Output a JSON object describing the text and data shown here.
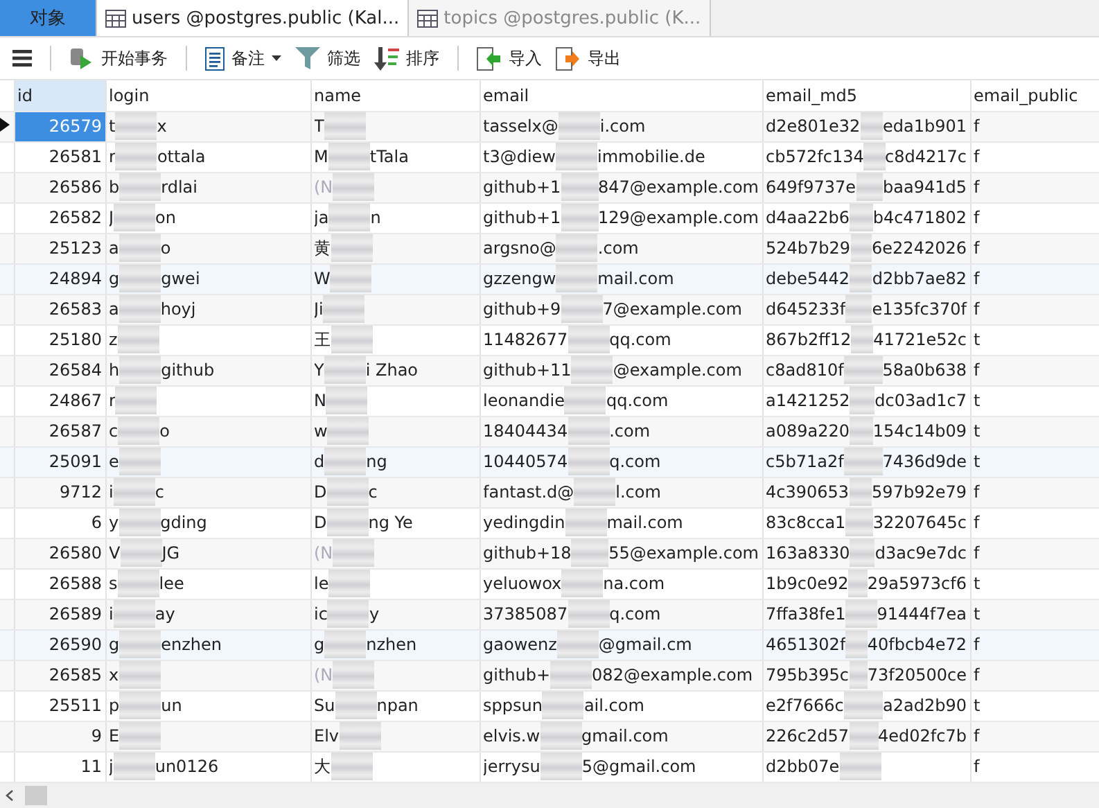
{
  "objects_tab": {
    "label": "对象"
  },
  "tabs": [
    {
      "kind": "table",
      "label": "users @postgres.public (Kal...",
      "selected": true
    },
    {
      "kind": "table",
      "label": "topics @postgres.public (K...",
      "selected": false
    }
  ],
  "toolbar": [
    {
      "kind": "menu"
    },
    {
      "kind": "transaction",
      "label": "开始事务"
    },
    {
      "kind": "note",
      "label": "备注"
    },
    {
      "kind": "filter",
      "label": "筛选"
    },
    {
      "kind": "sort",
      "label": "排序"
    },
    {
      "kind": "import",
      "label": "导入"
    },
    {
      "kind": "export",
      "label": "导出"
    }
  ],
  "columns": [
    {
      "label": "id",
      "selected": true
    },
    {
      "label": "login",
      "selected": false
    },
    {
      "label": "name",
      "selected": false
    },
    {
      "label": "email",
      "selected": false
    },
    {
      "label": "email_md5",
      "selected": false
    },
    {
      "label": "email_public",
      "selected": false
    }
  ],
  "rows": [
    {
      "selected": true,
      "id": "26579",
      "login": [
        "t",
        "x"
      ],
      "name": {
        "kind": "text",
        "parts": [
          "T"
        ]
      },
      "email": [
        "tasselx@",
        "i.com"
      ],
      "email_md5": [
        "d2e801e32",
        "eda1b901"
      ],
      "email_public": "f"
    },
    {
      "selected": false,
      "id": "26581",
      "login": [
        "r",
        "ottala"
      ],
      "name": {
        "kind": "text",
        "parts": [
          "M",
          "tTala"
        ]
      },
      "email": [
        "t3@diew",
        "immobilie.de"
      ],
      "email_md5": [
        "cb572fc134",
        "c8d4217c"
      ],
      "email_public": "f"
    },
    {
      "selected": false,
      "id": "26586",
      "login": [
        "b",
        "rdlai"
      ],
      "name": {
        "kind": "null",
        "parts": [
          "(N"
        ]
      },
      "email": [
        "github+1",
        "847@example.com"
      ],
      "email_md5": [
        "649f9737e",
        "baa941d5"
      ],
      "email_public": "f"
    },
    {
      "selected": false,
      "id": "26582",
      "login": [
        "J",
        "on"
      ],
      "name": {
        "kind": "text",
        "parts": [
          "ja",
          "n"
        ]
      },
      "email": [
        "github+1",
        "129@example.com"
      ],
      "email_md5": [
        "d4aa22b6",
        "b4c471802"
      ],
      "email_public": "f"
    },
    {
      "selected": false,
      "id": "25123",
      "login": [
        "a",
        "o"
      ],
      "name": {
        "kind": "text",
        "parts": [
          "黄"
        ]
      },
      "email": [
        "argsno@",
        ".com"
      ],
      "email_md5": [
        "524b7b29",
        "6e2242026"
      ],
      "email_public": "f"
    },
    {
      "selected": false,
      "id": "24894",
      "login": [
        "g",
        "gwei"
      ],
      "name": {
        "kind": "text",
        "parts": [
          "W"
        ]
      },
      "email": [
        "gzzengw",
        "mail.com"
      ],
      "email_md5": [
        "debe5442",
        "d2bb7ae82"
      ],
      "email_public": "f"
    },
    {
      "selected": false,
      "id": "26583",
      "login": [
        "a",
        "hoyj"
      ],
      "name": {
        "kind": "text",
        "parts": [
          "Ji"
        ]
      },
      "email": [
        "github+9",
        "7@example.com"
      ],
      "email_md5": [
        "d645233f",
        "e135fc370f"
      ],
      "email_public": "f"
    },
    {
      "selected": false,
      "id": "25180",
      "login": [
        "z"
      ],
      "name": {
        "kind": "text",
        "parts": [
          "王"
        ]
      },
      "email": [
        "11482677",
        "qq.com"
      ],
      "email_md5": [
        "867b2ff12",
        "41721e52c"
      ],
      "email_public": "t"
    },
    {
      "selected": false,
      "id": "26584",
      "login": [
        "h",
        "github"
      ],
      "name": {
        "kind": "text",
        "parts": [
          "Y",
          "i Zhao"
        ]
      },
      "email": [
        "github+11",
        "@example.com"
      ],
      "email_md5": [
        "c8ad810f",
        "58a0b638"
      ],
      "email_public": "f"
    },
    {
      "selected": false,
      "id": "24867",
      "login": [
        "r"
      ],
      "name": {
        "kind": "text",
        "parts": [
          "N"
        ]
      },
      "email": [
        "leonandie",
        "qq.com"
      ],
      "email_md5": [
        "a1421252",
        "dc03ad1c7"
      ],
      "email_public": "t"
    },
    {
      "selected": false,
      "id": "26587",
      "login": [
        "c",
        "o"
      ],
      "name": {
        "kind": "text",
        "parts": [
          "w"
        ]
      },
      "email": [
        "18404434",
        ".com"
      ],
      "email_md5": [
        "a089a220",
        "154c14b09"
      ],
      "email_public": "t"
    },
    {
      "selected": false,
      "id": "25091",
      "login": [
        "e"
      ],
      "name": {
        "kind": "text",
        "parts": [
          "d",
          "ng"
        ]
      },
      "email": [
        "10440574",
        "q.com"
      ],
      "email_md5": [
        "c5b71a2f",
        "7436d9de"
      ],
      "email_public": "t"
    },
    {
      "selected": false,
      "id": "9712",
      "login": [
        "i",
        "c"
      ],
      "name": {
        "kind": "text",
        "parts": [
          "D",
          "c"
        ]
      },
      "email": [
        "fantast.d@",
        "l.com"
      ],
      "email_md5": [
        "4c390653",
        "597b92e79"
      ],
      "email_public": "f"
    },
    {
      "selected": false,
      "id": "6",
      "login": [
        "y",
        "gding"
      ],
      "name": {
        "kind": "text",
        "parts": [
          "D",
          "ng Ye"
        ]
      },
      "email": [
        "yedingdin",
        "mail.com"
      ],
      "email_md5": [
        "83c8cca1",
        "32207645c"
      ],
      "email_public": "f"
    },
    {
      "selected": false,
      "id": "26580",
      "login": [
        "V",
        "JG"
      ],
      "name": {
        "kind": "null",
        "parts": [
          "(N"
        ]
      },
      "email": [
        "github+18",
        "55@example.com"
      ],
      "email_md5": [
        "163a8330",
        "d3ac9e7dc"
      ],
      "email_public": "f"
    },
    {
      "selected": false,
      "id": "26588",
      "login": [
        "s",
        "lee"
      ],
      "name": {
        "kind": "text",
        "parts": [
          "le"
        ]
      },
      "email": [
        "yeluowox",
        "na.com"
      ],
      "email_md5": [
        "1b9c0e92",
        "29a5973cf6"
      ],
      "email_public": "t"
    },
    {
      "selected": false,
      "id": "26589",
      "login": [
        "i",
        "ay"
      ],
      "name": {
        "kind": "text",
        "parts": [
          "ic",
          "y"
        ]
      },
      "email": [
        "37385087",
        "q.com"
      ],
      "email_md5": [
        "7ffa38fe1",
        "91444f7ea"
      ],
      "email_public": "t"
    },
    {
      "selected": false,
      "id": "26590",
      "login": [
        "g",
        "enzhen"
      ],
      "name": {
        "kind": "text",
        "parts": [
          "g",
          "nzhen"
        ]
      },
      "email": [
        "gaowenz",
        "@gmail.cm"
      ],
      "email_md5": [
        "4651302f",
        "40fbcb4e72"
      ],
      "email_public": "f"
    },
    {
      "selected": false,
      "id": "26585",
      "login": [
        "x"
      ],
      "name": {
        "kind": "null",
        "parts": [
          "(N"
        ]
      },
      "email": [
        "github+",
        "082@example.com"
      ],
      "email_md5": [
        "795b395c",
        "73f20500ce"
      ],
      "email_public": "f"
    },
    {
      "selected": false,
      "id": "25511",
      "login": [
        "p",
        "un"
      ],
      "name": {
        "kind": "text",
        "parts": [
          "Su",
          "npan"
        ]
      },
      "email": [
        "sppsun",
        "ail.com"
      ],
      "email_md5": [
        "e2f7666c",
        "a2ad2b90"
      ],
      "email_public": "t"
    },
    {
      "selected": false,
      "id": "9",
      "login": [
        "E"
      ],
      "name": {
        "kind": "text",
        "parts": [
          "Elv"
        ]
      },
      "email": [
        "elvis.w",
        "gmail.com"
      ],
      "email_md5": [
        "226c2d57",
        "4ed02fc7b"
      ],
      "email_public": "f"
    },
    {
      "selected": false,
      "id": "11",
      "login": [
        "j",
        "un0126"
      ],
      "name": {
        "kind": "text",
        "parts": [
          "大"
        ]
      },
      "email": [
        "jerrysu",
        "5@gmail.com"
      ],
      "email_md5": [
        "d2bb07e"
      ],
      "email_public": "f"
    }
  ]
}
